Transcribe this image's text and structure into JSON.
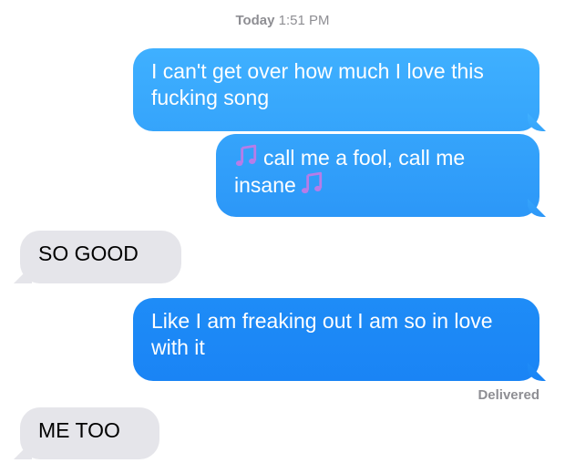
{
  "header": {
    "timestamp_day": "Today",
    "timestamp_time": "1:51 PM"
  },
  "messages": [
    {
      "direction": "sent",
      "text": "I can't get over how much I love this fucking song"
    },
    {
      "direction": "sent",
      "icon_before": "musical-notes-icon",
      "text": "call me a fool, call me insane",
      "icon_after": "musical-notes-icon"
    },
    {
      "direction": "received",
      "text": "SO GOOD"
    },
    {
      "direction": "sent",
      "text": "Like I am freaking out I am so in love with it"
    },
    {
      "direction": "received",
      "text": "ME TOO"
    }
  ],
  "status": {
    "delivered_label": "Delivered"
  },
  "colors": {
    "sent_bubble_top": "#3fb0ff",
    "sent_bubble_bottom": "#1a84f5",
    "received_bubble": "#e5e5ea",
    "meta_text": "#8e8e93",
    "music_note": "#b77ce8"
  }
}
